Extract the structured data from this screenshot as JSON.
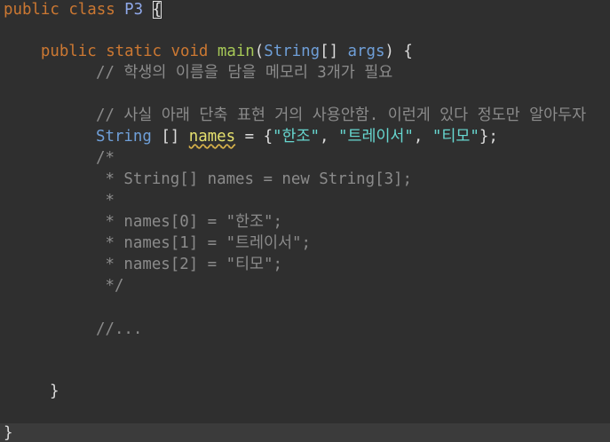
{
  "code": {
    "line1": {
      "kw_public": "public",
      "kw_class": "class",
      "class_name": "P3",
      "open_brace": "{"
    },
    "line3": {
      "kw_public": "public",
      "kw_static": "static",
      "kw_void": "void",
      "method_name": "main",
      "open_paren": "(",
      "param_type": "String",
      "brackets": "[]",
      "param_name": "args",
      "close_paren": ")",
      "open_brace": "{"
    },
    "comment1": "// 학생의 이름을 담을 메모리 3개가 필요",
    "comment2": "// 사실 아래 단축 표현 거의 사용안함. 이런게 있다 정도만 알아두자",
    "line7": {
      "type": "String",
      "brackets": "[]",
      "var_name": "names",
      "equals": "=",
      "open_brace": "{",
      "str1": "\"한조\"",
      "comma": ",",
      "str2": "\"트레이서\"",
      "str3": "\"티모\"",
      "close": "};"
    },
    "block_comment": [
      "/*",
      " * String[] names = new String[3];",
      " *",
      " * names[0] = \"한조\";",
      " * names[1] = \"트레이서\";",
      " * names[2] = \"티모\";",
      " */"
    ],
    "comment_ellipsis": "//...",
    "method_close": "}",
    "class_close": "}"
  }
}
